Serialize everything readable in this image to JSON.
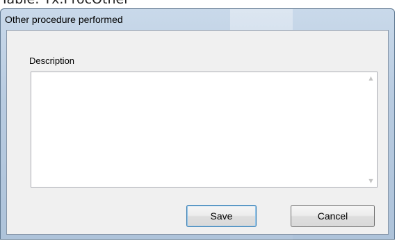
{
  "background": {
    "top_text": "Table: Tx.ProcOther"
  },
  "dialog": {
    "title": "Other procedure performed",
    "description_label": "Description",
    "description_value": "",
    "save_label": "Save",
    "cancel_label": "Cancel"
  },
  "icons": {
    "scroll_up": "scroll-up-arrow",
    "scroll_down": "scroll-down-arrow"
  },
  "colors": {
    "window_frame": "#b8cbe0",
    "client_background": "#f0f0f0",
    "default_button_border": "#3c7fb1"
  }
}
